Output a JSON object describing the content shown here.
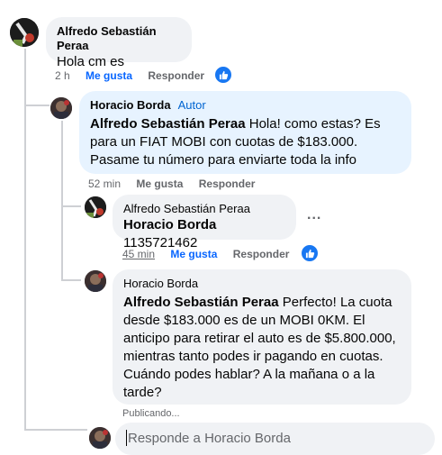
{
  "comments": {
    "c1": {
      "author": "Alfredo Sebastián Peraa",
      "text": "Hola cm es",
      "time": "2 h",
      "like": "Me gusta",
      "reply": "Responder"
    },
    "c2": {
      "author": "Horacio Borda",
      "badge": "Autor",
      "mention": "Alfredo Sebastián Peraa",
      "text": " Hola! como estas? Es para un FIAT MOBI con cuotas de $183.000. Pasame tu número para enviarte toda la info",
      "time": "52 min",
      "like": "Me gusta",
      "reply": "Responder"
    },
    "c3": {
      "author": "Alfredo Sebastián Peraa",
      "mention": "Horacio Borda",
      "text": " 1135721462",
      "time": "45 min",
      "like": "Me gusta",
      "reply": "Responder"
    },
    "c4": {
      "author": "Horacio Borda",
      "mention": "Alfredo Sebastián Peraa",
      "text": " Perfecto! La cuota desde $183.000 es de un MOBI 0KM. El anticipo para retirar el auto es de $5.800.000, mientras tanto podes ir pagando en cuotas. Cuándo podes hablar? A la mañana o a la tarde?",
      "status": "Publicando..."
    }
  },
  "reply_box": {
    "placeholder": "Responde a Horacio Borda"
  },
  "more_menu": "...",
  "colors": {
    "accent": "#1877f2",
    "bubble": "#f0f2f5",
    "author_bubble": "#e7f3ff",
    "meta": "#65676b"
  }
}
